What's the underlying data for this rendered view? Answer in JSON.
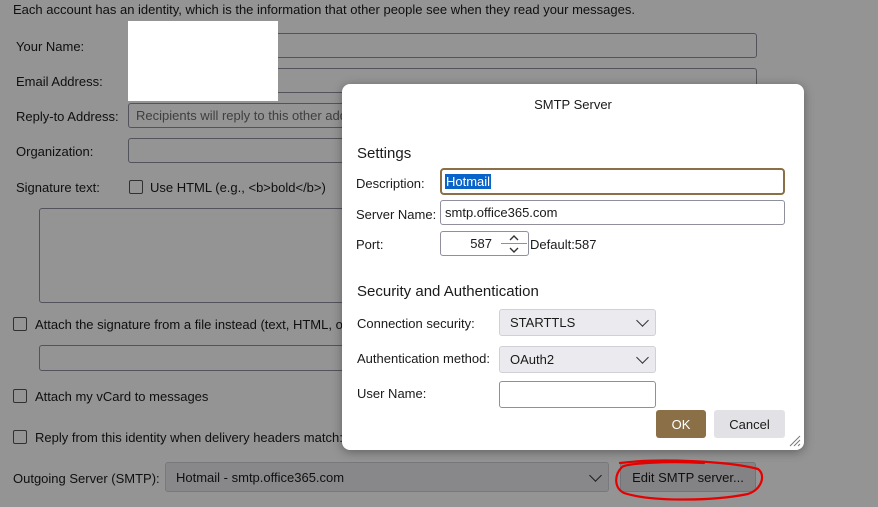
{
  "background": {
    "intro": "Each account has an identity, which is the information that other people see when they read your messages.",
    "your_name_label": "Your Name:",
    "email_label": "Email Address:",
    "reply_to_label": "Reply-to Address:",
    "reply_to_placeholder": "Recipients will reply to this other address",
    "organization_label": "Organization:",
    "signature_label": "Signature text:",
    "use_html_label": "Use HTML (e.g., <b>bold</b>)",
    "attach_sig_label": "Attach the signature from a file instead (text, HTML, or image):",
    "attach_vcard_label": "Attach my vCard to messages",
    "reply_identity_label": "Reply from this identity when delivery headers match:",
    "outgoing_label": "Outgoing Server (SMTP):",
    "outgoing_value": "Hotmail - smtp.office365.com",
    "edit_smtp_label": "Edit SMTP server..."
  },
  "dialog": {
    "title": "SMTP Server",
    "settings_heading": "Settings",
    "description_label": "Description:",
    "description_value": "Hotmail",
    "server_name_label": "Server Name:",
    "server_name_value": "smtp.office365.com",
    "port_label": "Port:",
    "port_value": "587",
    "default_port_text": "Default:587",
    "security_heading": "Security and Authentication",
    "connection_security_label": "Connection security:",
    "connection_security_value": "STARTTLS",
    "auth_method_label": "Authentication method:",
    "auth_method_value": "OAuth2",
    "username_label": "User Name:",
    "username_value": "",
    "ok_label": "OK",
    "cancel_label": "Cancel"
  },
  "colors": {
    "overlay": "rgba(0,0,0,0.42)",
    "ok_button": "#8b6f47",
    "focus_ring": "#8b6f47",
    "selection": "#0a63c9",
    "annotation": "#e60000"
  }
}
